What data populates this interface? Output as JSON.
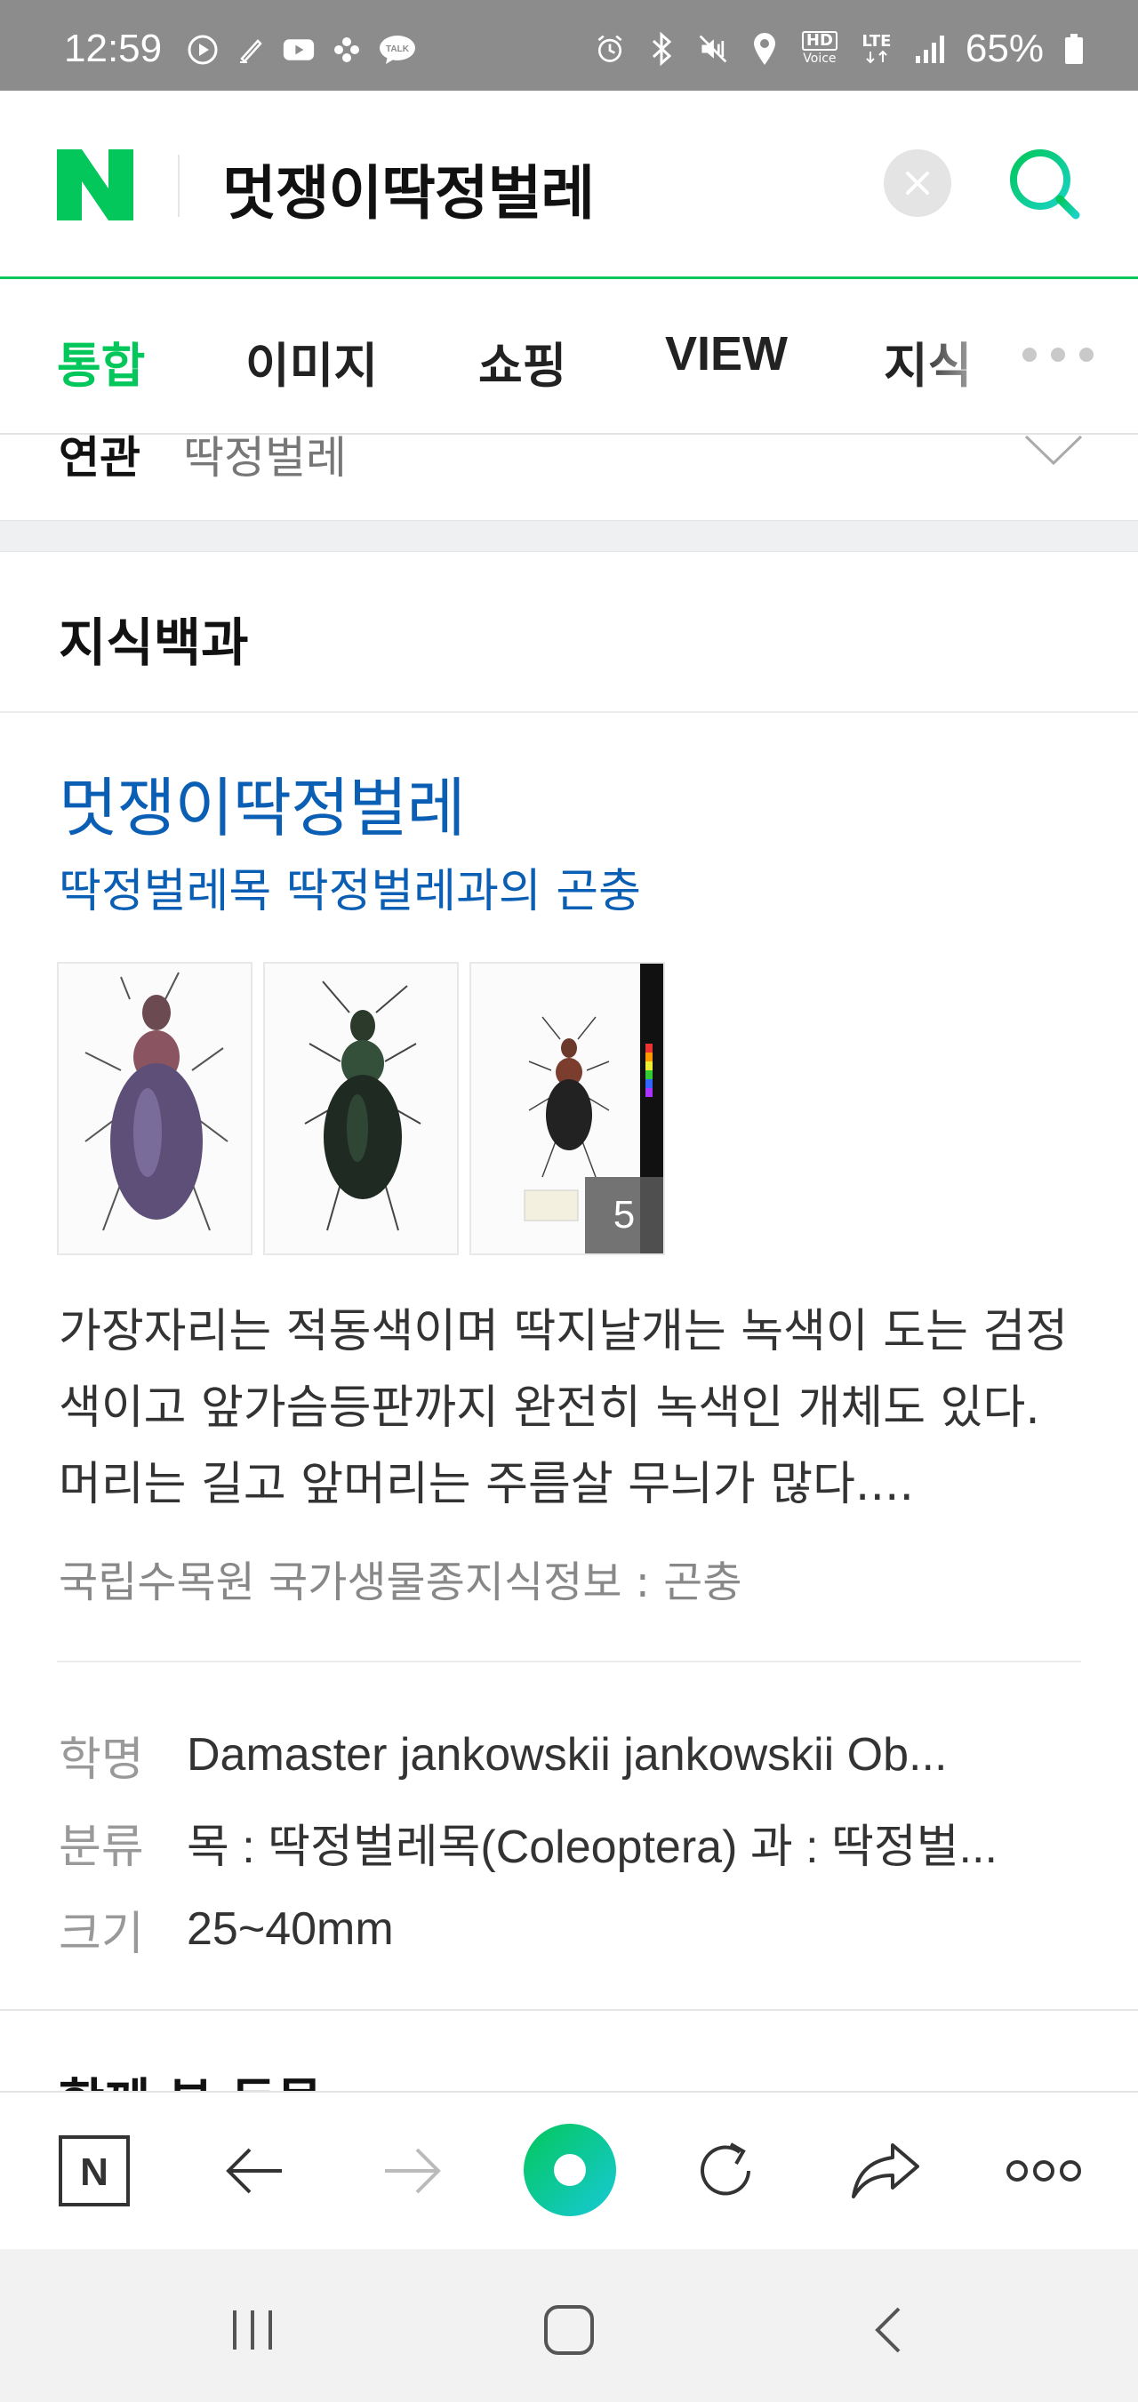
{
  "status_bar": {
    "time": "12:59",
    "battery": "65%",
    "hd_voice": "HD",
    "voice": "Voice",
    "lte": "LTE",
    "left_icons": [
      "play-circle-icon",
      "pen-icon",
      "youtube-icon",
      "flower-icon",
      "talk-icon"
    ],
    "right_icons": [
      "alarm-icon",
      "bluetooth-icon",
      "mute-icon",
      "location-icon",
      "hd-voice-icon",
      "lte-icon",
      "signal-icon",
      "battery-icon"
    ],
    "talk_badge": "TALK"
  },
  "header": {
    "logo": "N",
    "query": "멋쟁이딱정벌레",
    "brand_color": "#03c75a"
  },
  "tabs": {
    "items": [
      "통합",
      "이미지",
      "쇼핑",
      "VIEW",
      "지식"
    ],
    "active_index": 0
  },
  "related": {
    "label": "연관",
    "value": "딱정벌레"
  },
  "knowledge": {
    "section_title": "지식백과",
    "title": "멋쟁이딱정벌레",
    "subtitle": "딱정벌레목 딱정벌레과의 곤충",
    "image_count": "5",
    "description": "가장자리는 적동색이며 딱지날개는 녹색이 도는 검정색이고 앞가슴등판까지 완전히 녹색인 개체도 있다. 머리는 길고 앞머리는 주름살 무늬가 많다....",
    "source": "국립수목원 국가생물종지식정보 : 곤충",
    "info": [
      {
        "key": "학명",
        "value": "Damaster jankowskii jankowskii Ob..."
      },
      {
        "key": "분류",
        "value": "목 : 딱정벌레목(Coleoptera) 과 : 딱정벌..."
      },
      {
        "key": "크기",
        "value": "25~40mm"
      }
    ],
    "next_section": "함께 본 동물"
  },
  "toolbar": {
    "n_label": "N",
    "icons": [
      "naver-home-icon",
      "back-arrow-icon",
      "forward-arrow-icon",
      "green-dot-icon",
      "reload-icon",
      "share-icon",
      "more-icon"
    ]
  },
  "navbar": {
    "icons": [
      "recent-apps-icon",
      "home-icon",
      "back-icon"
    ]
  }
}
